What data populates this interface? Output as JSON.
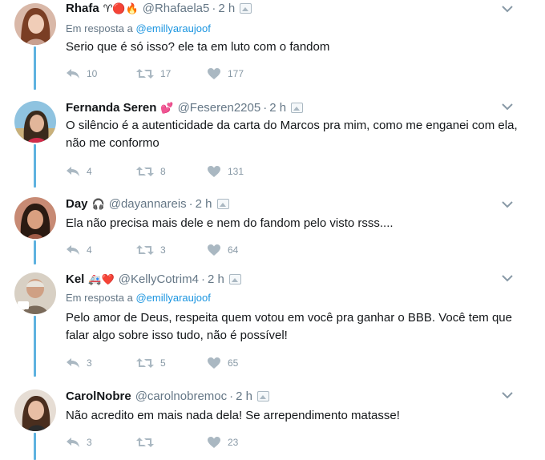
{
  "tweets": [
    {
      "name": "Rhafa",
      "emoji": "♈🔴🔥",
      "handle": "@Rhafaela5",
      "time": "2 h",
      "reply_label": "Em resposta a",
      "reply_to": "@emillyaraujoof",
      "text": "Serio que é só isso? ele ta em luto com o fandom",
      "replies": "10",
      "retweets": "17",
      "likes": "177"
    },
    {
      "name": "Fernanda Seren",
      "emoji": "💕",
      "handle": "@Feseren2205",
      "time": "2 h",
      "text": "O silêncio é a autenticidade da carta do Marcos pra mim, como me enganei com ela, não me conformo",
      "replies": "4",
      "retweets": "8",
      "likes": "131"
    },
    {
      "name": "Day",
      "emoji": "🎧",
      "handle": "@dayannareis",
      "time": "2 h",
      "text": "Ela não precisa mais dele e nem do fandom pelo visto rsss....",
      "replies": "4",
      "retweets": "3",
      "likes": "64"
    },
    {
      "name": "Kel",
      "emoji": "🚑❤️",
      "handle": "@KellyCotrim4",
      "time": "2 h",
      "reply_label": "Em resposta a",
      "reply_to": "@emillyaraujoof",
      "text": "Pelo amor de Deus, respeita quem votou em você pra ganhar o BBB. Você tem que falar algo sobre isso tudo, não é possível!",
      "replies": "3",
      "retweets": "5",
      "likes": "65"
    },
    {
      "name": "CarolNobre",
      "handle": "@carolnobremoc",
      "time": "2 h",
      "text": "Não acredito em mais nada dela! Se arrependimento matasse!",
      "replies": "3",
      "retweets": "",
      "likes": "23"
    }
  ],
  "separator": "·",
  "colors": {
    "thread_line": "#5eb2e0",
    "link": "#1b95e0",
    "muted": "#657786",
    "icon": "#8899a6"
  },
  "icons": {
    "reply": "reply-icon",
    "retweet": "retweet-icon",
    "like": "heart-icon",
    "menu": "chevron-down-icon",
    "media": "image-icon"
  }
}
